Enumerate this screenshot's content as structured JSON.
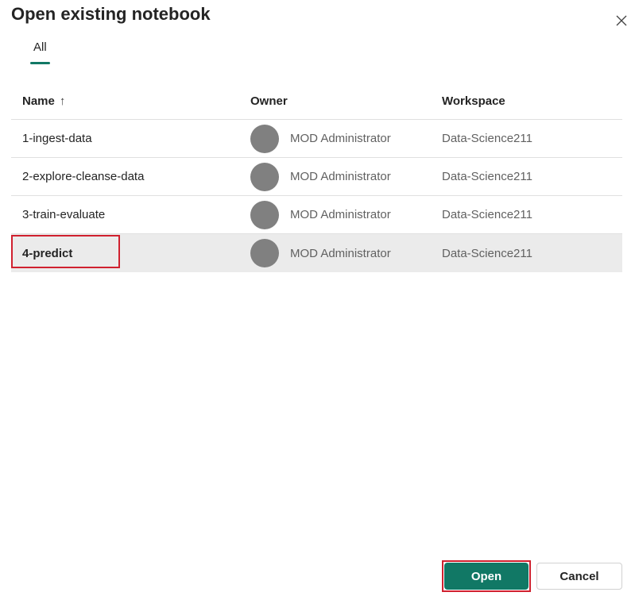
{
  "dialog": {
    "title": "Open existing notebook",
    "close_icon": "close-icon"
  },
  "tabs": [
    {
      "label": "All",
      "active": true
    }
  ],
  "table": {
    "columns": {
      "name": "Name",
      "name_sort": "↑",
      "owner": "Owner",
      "workspace": "Workspace"
    },
    "rows": [
      {
        "name": "1-ingest-data",
        "owner": "MOD Administrator",
        "workspace": "Data-Science211",
        "selected": false
      },
      {
        "name": "2-explore-cleanse-data",
        "owner": "MOD Administrator",
        "workspace": "Data-Science211",
        "selected": false
      },
      {
        "name": "3-train-evaluate",
        "owner": "MOD Administrator",
        "workspace": "Data-Science211",
        "selected": false
      },
      {
        "name": "4-predict",
        "owner": "MOD Administrator",
        "workspace": "Data-Science211",
        "selected": true
      }
    ]
  },
  "footer": {
    "open_label": "Open",
    "cancel_label": "Cancel"
  },
  "colors": {
    "accent": "#117865",
    "highlight": "#d0212f",
    "avatar": "#808080",
    "selected_row": "#ebebeb"
  }
}
